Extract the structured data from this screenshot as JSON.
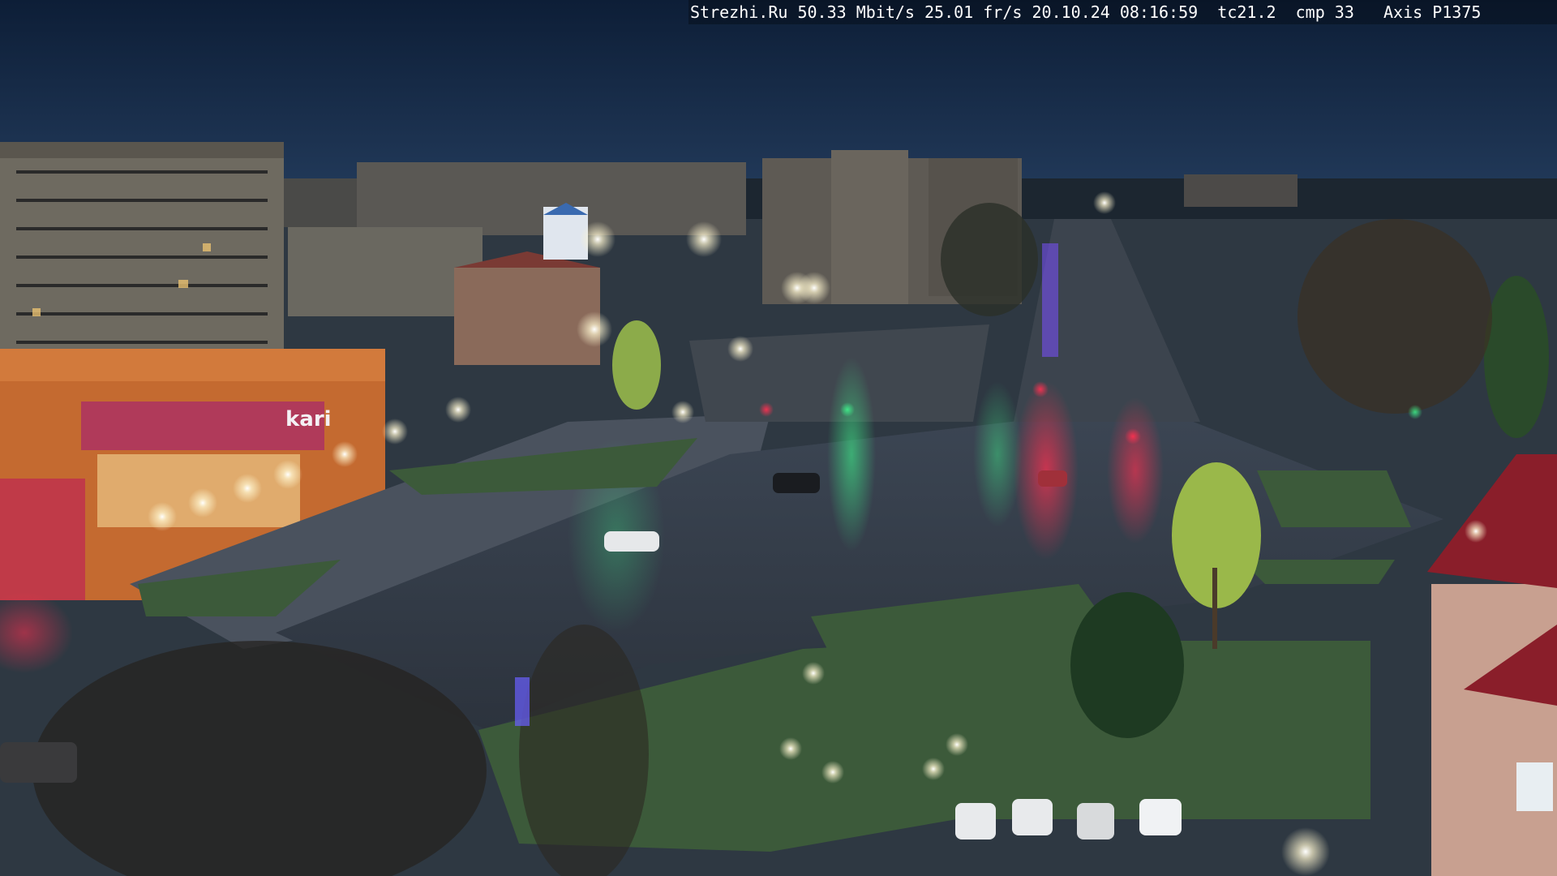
{
  "camera_overlay": {
    "site": "Strezhi.Ru",
    "bitrate": "50.33 Mbit/s",
    "framerate": "25.01 fr/s",
    "datetime": "20.10.24 08:16:59",
    "tc": "tc21.2",
    "cmp": "cmp 33",
    "camera_model": "Axis P1375"
  },
  "scene": {
    "store_sign": "kari",
    "sky_color": "#1a3050",
    "road_color": "#3a4450"
  }
}
